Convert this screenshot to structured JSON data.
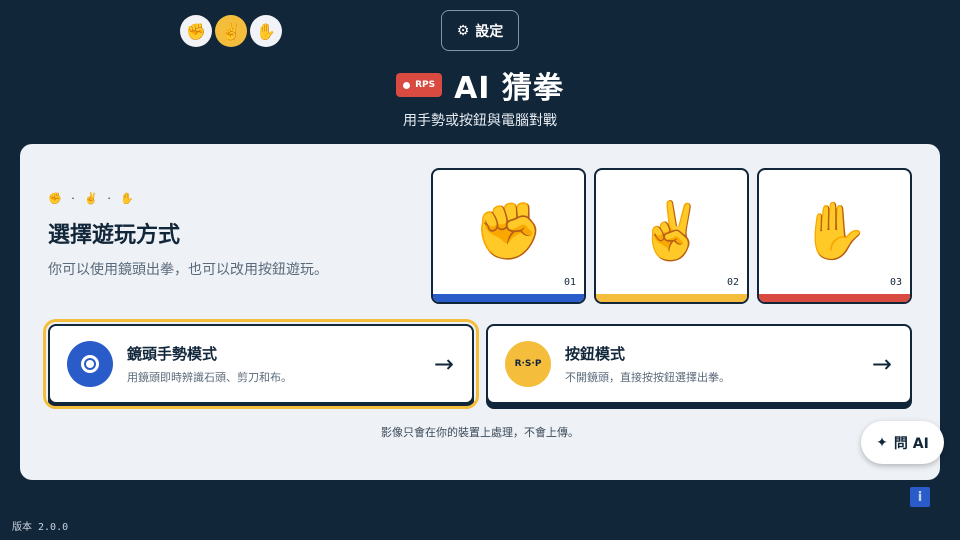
{
  "header": {
    "hand_icons": [
      {
        "icon": "fist-icon",
        "glyph": "✊",
        "active": false
      },
      {
        "icon": "victory-hand-icon",
        "glyph": "✌️",
        "active": true
      },
      {
        "icon": "raised-hand-icon",
        "glyph": "✋",
        "active": false
      }
    ],
    "settings_label": "設定",
    "settings_icon": "gear-icon",
    "badge_label": "RPS",
    "title": "AI 猜拳",
    "subtitle": "用手勢或按鈕與電腦對戰"
  },
  "panel": {
    "mini_hands": "✊ · ✌️ · ✋",
    "title": "選擇遊玩方式",
    "description": "你可以使用鏡頭出拳，也可以改用按鈕遊玩。",
    "cards": [
      {
        "emoji": "✊",
        "number": "01",
        "color": "#2a5cc9",
        "icon": "fist-icon"
      },
      {
        "emoji": "✌️",
        "number": "02",
        "color": "#f4be3c",
        "icon": "victory-hand-icon"
      },
      {
        "emoji": "✋",
        "number": "03",
        "color": "#d94a40",
        "icon": "raised-hand-icon"
      }
    ],
    "modes": {
      "camera": {
        "title": "鏡頭手勢模式",
        "description": "用鏡頭即時辨識石頭、剪刀和布。",
        "icon": "camera-lens-icon",
        "selected": true
      },
      "button": {
        "title": "按鈕模式",
        "description": "不開鏡頭，直接按按鈕選擇出拳。",
        "icon_text": "R·S·P",
        "selected": false
      }
    },
    "arrow": "→",
    "privacy_note": "影像只會在你的裝置上處理，不會上傳。"
  },
  "ask_ai": {
    "label": "問 AI",
    "icon": "sparkle-icon",
    "glyph": "✦"
  },
  "info": {
    "label": "i"
  },
  "version": "版本 2.0.0",
  "colors": {
    "background": "#12263a",
    "panel": "#eef1f5",
    "accent_yellow": "#f4be3c",
    "accent_blue": "#2a5cc9",
    "accent_red": "#d94a40"
  }
}
